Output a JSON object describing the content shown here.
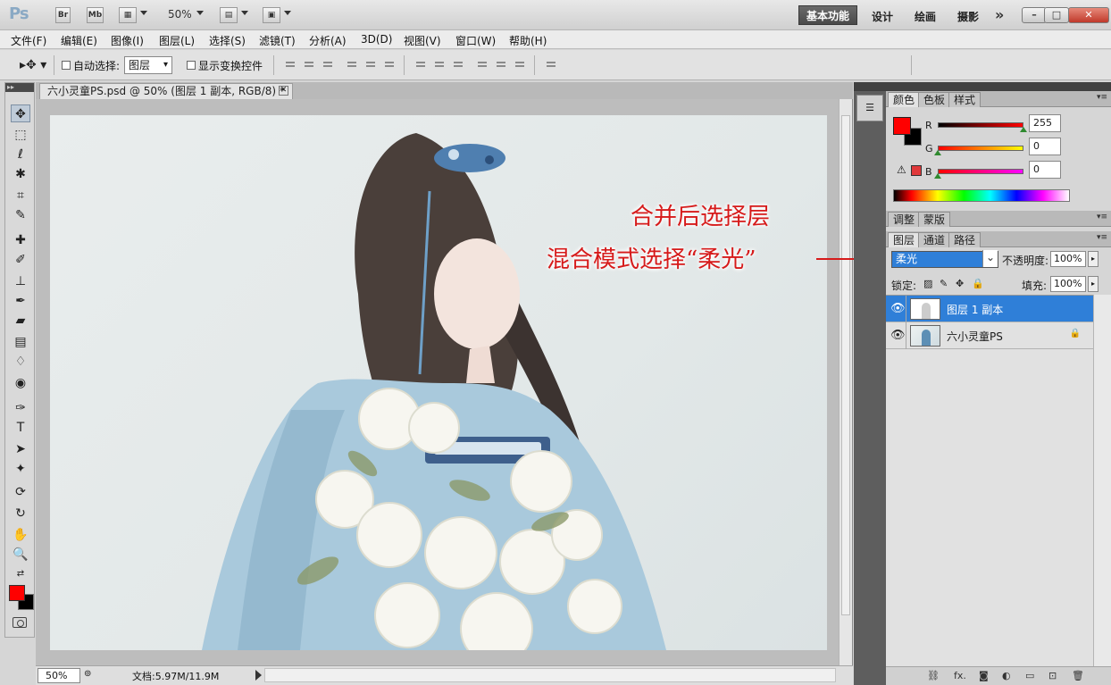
{
  "titlebar": {
    "logo": "Ps",
    "bridge": "Br",
    "minibridge": "Mb",
    "zoom": "50%",
    "workspace_active": "基本功能",
    "workspaces": [
      "设计",
      "绘画",
      "摄影"
    ],
    "more": "»"
  },
  "menubar": [
    "文件(F)",
    "编辑(E)",
    "图像(I)",
    "图层(L)",
    "选择(S)",
    "滤镜(T)",
    "分析(A)",
    "3D(D)",
    "视图(V)",
    "窗口(W)",
    "帮助(H)"
  ],
  "options": {
    "auto_select_label": "自动选择:",
    "auto_select_target": "图层",
    "show_transform_label": "显示变换控件"
  },
  "document": {
    "tab_title": "六小灵童PS.psd @ 50% (图层 1 副本, RGB/8) *",
    "zoom": "50%",
    "doc_info": "文档:5.97M/11.9M"
  },
  "annotation": {
    "line1": "合并后选择层",
    "line2": "混合模式选择“柔光”"
  },
  "color_panel": {
    "tabs": [
      "颜色",
      "色板",
      "样式"
    ],
    "channels": [
      {
        "name": "R",
        "value": "255",
        "level": 1.0
      },
      {
        "name": "G",
        "value": "0",
        "level": 0.0
      },
      {
        "name": "B",
        "value": "0",
        "level": 0.0
      }
    ],
    "foreground": "#ff0000",
    "background": "#000000"
  },
  "adjust_panel": {
    "tabs": [
      "调整",
      "蒙版"
    ]
  },
  "layers_panel": {
    "tabs": [
      "图层",
      "通道",
      "路径"
    ],
    "blend_mode": "柔光",
    "opacity_label": "不透明度:",
    "opacity": "100%",
    "lock_label": "锁定:",
    "fill_label": "填充:",
    "fill": "100%",
    "layers": [
      {
        "name": "图层 1 副本",
        "selected": true,
        "locked": false
      },
      {
        "name": "六小灵童PS",
        "selected": false,
        "locked": true
      }
    ]
  }
}
